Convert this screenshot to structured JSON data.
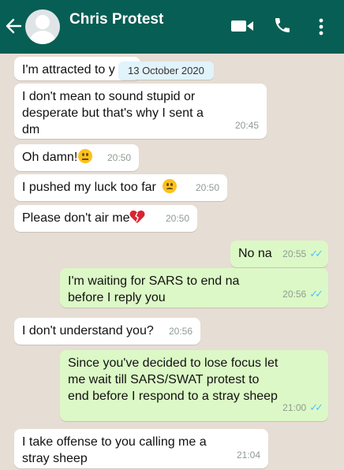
{
  "header": {
    "contact_name": "Chris Protest",
    "back_icon": "arrow-left-icon",
    "video_icon": "video-call-icon",
    "call_icon": "phone-icon",
    "menu_icon": "more-vert-icon",
    "color": "#075e54"
  },
  "date_chip": "13 October 2020",
  "messages": [
    {
      "dir": "in",
      "text": "I'm attracted to y",
      "time": ""
    },
    {
      "dir": "in",
      "text": "I don't mean to sound stupid or desperate but that's why I sent a dm",
      "time": "20:45"
    },
    {
      "dir": "in",
      "text": "Oh damn!",
      "emoji": "eye-roll-emoji",
      "time": "20:50"
    },
    {
      "dir": "in",
      "text": "I pushed my luck too far",
      "emoji": "sad-face-emoji",
      "time": "20:50"
    },
    {
      "dir": "in",
      "text": "Please don't air me",
      "emoji": "broken-heart-emoji",
      "time": "20:50"
    },
    {
      "dir": "out",
      "text": "No na",
      "time": "20:55",
      "status": "read"
    },
    {
      "dir": "out",
      "text": "I'm waiting for SARS to end na before I reply you",
      "time": "20:56",
      "status": "read"
    },
    {
      "dir": "in",
      "text": "I don't understand you?",
      "time": "20:56"
    },
    {
      "dir": "out",
      "text": "Since you've decided to lose focus let me wait till SARS/SWAT protest to end before I respond to a stray sheep",
      "time": "21:00",
      "status": "read"
    },
    {
      "dir": "in",
      "text": "I take offense to you calling me a stray sheep",
      "time": "21:04"
    }
  ],
  "colors": {
    "incoming_bubble": "#ffffff",
    "outgoing_bubble": "#dcf8c6",
    "read_ticks": "#4fc3f7",
    "chat_background": "#e6ddd4"
  }
}
